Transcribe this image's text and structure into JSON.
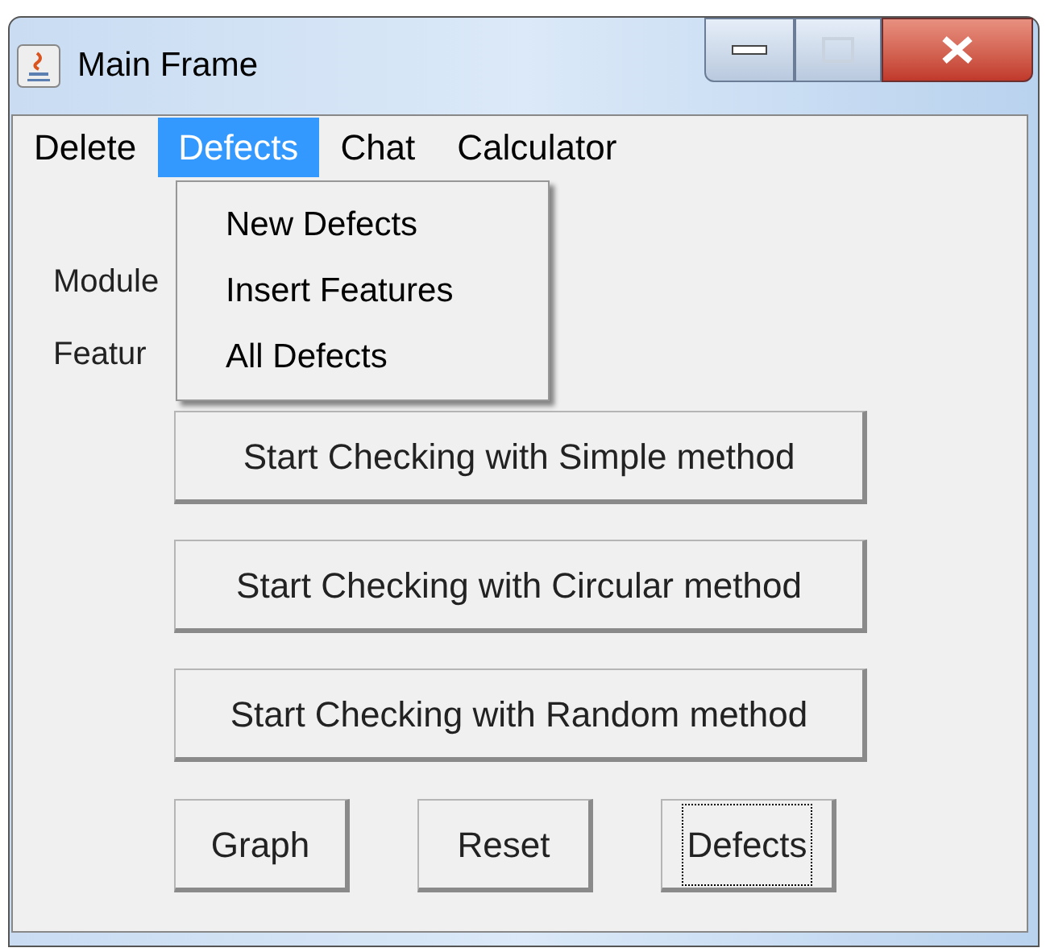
{
  "window": {
    "title": "Main Frame"
  },
  "menu_bar": [
    {
      "label": "Delete",
      "selected": false
    },
    {
      "label": "Defects",
      "selected": true
    },
    {
      "label": "Chat",
      "selected": false
    },
    {
      "label": "Calculator",
      "selected": false
    }
  ],
  "dropdown": [
    "New Defects",
    "Insert Features",
    "All Defects"
  ],
  "labels": [
    "Module",
    "Featur"
  ],
  "method_buttons": [
    {
      "label": "Start Checking with Simple method",
      "focused": false
    },
    {
      "label": "Start Checking with Circular method",
      "focused": false
    },
    {
      "label": "Start Checking with Random method",
      "focused": false
    }
  ],
  "bottom_buttons": [
    {
      "label": "Graph",
      "focused": false
    },
    {
      "label": "Reset",
      "focused": false
    },
    {
      "label": "Defects",
      "focused": true
    }
  ]
}
